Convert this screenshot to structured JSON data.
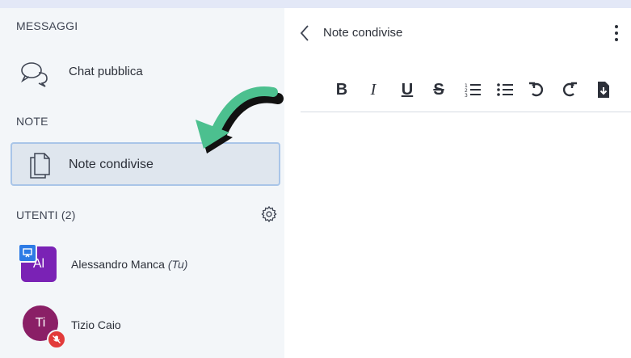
{
  "sidebar": {
    "messages_heading": "MESSAGGI",
    "public_chat_label": "Chat pubblica",
    "notes_heading": "NOTE",
    "shared_notes_label": "Note condivise",
    "users_heading": "UTENTI (2)",
    "users": [
      {
        "initials": "Al",
        "name": "Alessandro Manca",
        "suffix": "(Tu)",
        "color": "#7a22b5"
      },
      {
        "initials": "Ti",
        "name": "Tizio Caio",
        "suffix": "",
        "color": "#8a1f66"
      }
    ]
  },
  "panel": {
    "title": "Note condivise",
    "toolbar": {
      "bold": "B",
      "italic": "I",
      "underline": "U",
      "strikethrough": "S"
    }
  },
  "colors": {
    "accent_arrow": "#4cc08f",
    "selected_border": "#a9c5e8",
    "presenter_badge": "#2d7be5",
    "muted_badge": "#e23b3b"
  }
}
